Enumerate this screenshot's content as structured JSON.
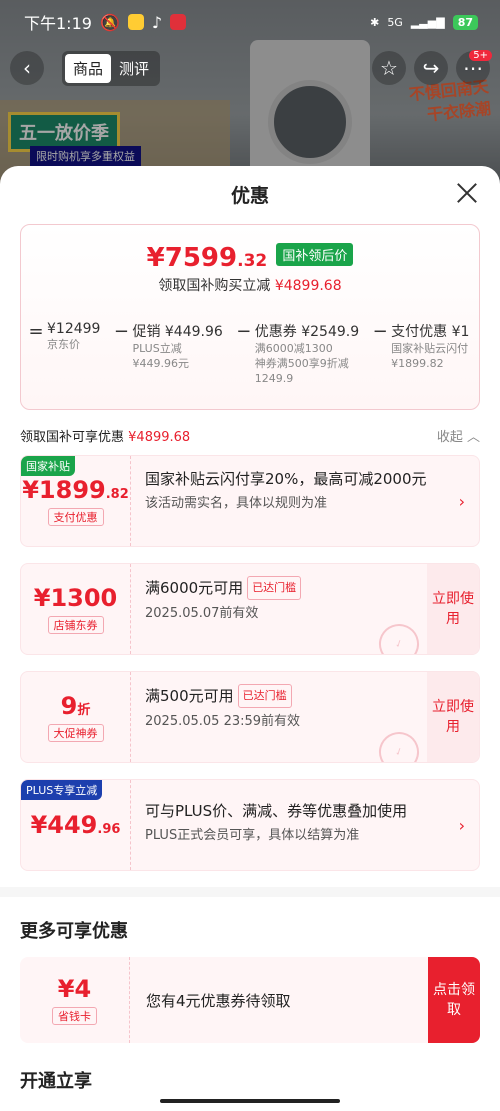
{
  "status": {
    "time": "下午1:19",
    "network": "5G",
    "battery": "87"
  },
  "nav": {
    "tab_product": "商品",
    "tab_review": "测评",
    "badge": "5+"
  },
  "background": {
    "promo_title": "五一放价季",
    "promo_sub": "限时购机享多重权益",
    "slogan_1": "不惧回南天",
    "slogan_2": "干衣除潮"
  },
  "sheet": {
    "title": "优惠"
  },
  "price": {
    "final_main": "¥7599",
    "final_dec": ".32",
    "final_tag": "国补领后价",
    "sub_text": "领取国补购买立减",
    "sub_amount": "¥4899.68"
  },
  "calc": {
    "op_eq": "=",
    "op_minus": "−",
    "terms": [
      {
        "top": "¥12499",
        "d1": "京东价",
        "d2": ""
      },
      {
        "top": "促销 ¥449.96",
        "d1": "PLUS立减",
        "d2": "¥449.96元"
      },
      {
        "top": "优惠券 ¥2549.9",
        "d1": "满6000减1300",
        "d2": "神券满500享9折减",
        "d3": "1249.9"
      },
      {
        "top": "支付优惠 ¥1",
        "d1": "国家补贴云闪付",
        "d2": "¥1899.82"
      }
    ]
  },
  "list": {
    "head": "领取国补可享优惠",
    "head_amount": "¥4899.68",
    "collapse": "收起"
  },
  "cards": [
    {
      "tag": "国家补贴",
      "amt_main": "¥1899",
      "amt_dec": ".82",
      "label": "支付优惠",
      "title": "国家补贴云闪付享20%，最高可减2000元",
      "sub": "该活动需实名，具体以规则为准"
    },
    {
      "amt_main": "¥1300",
      "label": "店铺东券",
      "title": "满6000元可用",
      "reached": "已达门槛",
      "sub": "2025.05.07前有效",
      "action": "立即使用"
    },
    {
      "amt_main": "9",
      "amt_unit": "折",
      "label": "大促神券",
      "title": "满500元可用",
      "reached": "已达门槛",
      "sub": "2025.05.05 23:59前有效",
      "action": "立即使用"
    },
    {
      "tag": "PLUS专享立减",
      "amt_main": "¥449",
      "amt_dec": ".96",
      "title": "可与PLUS价、满减、券等优惠叠加使用",
      "sub": "PLUS正式会员可享，具体以结算为准"
    }
  ],
  "more": {
    "title": "更多可享优惠",
    "amt": "¥4",
    "label": "省钱卡",
    "text": "您有4元优惠券待领取",
    "action": "点击领取"
  },
  "open": {
    "title": "开通立享"
  },
  "colors": {
    "accent": "#e8202e",
    "green": "#1aa44a",
    "plus_blue": "#1d3fae"
  }
}
